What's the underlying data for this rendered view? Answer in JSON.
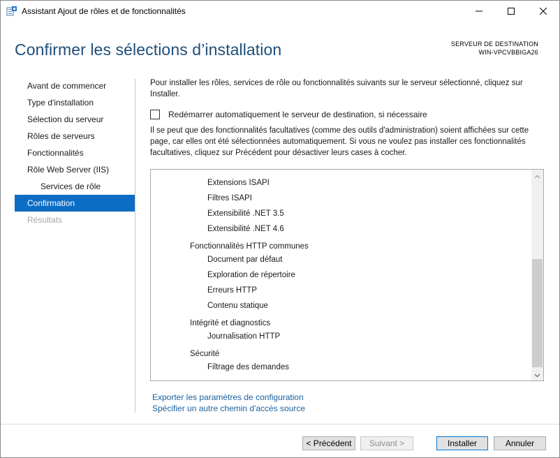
{
  "window": {
    "title": "Assistant Ajout de rôles et de fonctionnalités"
  },
  "header": {
    "page_title": "Confirmer les sélections d’installation",
    "destination_label": "SERVEUR DE DESTINATION",
    "destination_server": "WIN-VPCVBBIGA26"
  },
  "nav": {
    "items": [
      {
        "label": "Avant de commencer"
      },
      {
        "label": "Type d'installation"
      },
      {
        "label": "Sélection du serveur"
      },
      {
        "label": "Rôles de serveurs"
      },
      {
        "label": "Fonctionnalités"
      },
      {
        "label": "Rôle Web Server (IIS)"
      },
      {
        "label": "Services de rôle"
      },
      {
        "label": "Confirmation"
      },
      {
        "label": "Résultats"
      }
    ]
  },
  "content": {
    "intro": "Pour installer les rôles, services de rôle ou fonctionnalités suivants sur le serveur sélectionné, cliquez sur Installer.",
    "restart_checkbox_label": "Redémarrer automatiquement le serveur de destination, si nécessaire",
    "restart_checked": false,
    "note": "Il se peut que des fonctionnalités facultatives (comme des outils d'administration) soient affichées sur cette page, car elles ont été sélectionnées automatiquement. Si vous ne voulez pas installer ces fonctionnalités facultatives, cliquez sur Précédent pour désactiver leurs cases à cocher.",
    "list": [
      "Extensions ISAPI",
      "Filtres ISAPI",
      "Extensibilité .NET 3.5",
      "Extensibilité .NET 4.6",
      "Fonctionnalités HTTP communes",
      "Document par défaut",
      "Exploration de répertoire",
      "Erreurs HTTP",
      "Contenu statique",
      "Intégrité et diagnostics",
      "Journalisation HTTP",
      "Sécurité",
      "Filtrage des demandes"
    ],
    "export_link": "Exporter les paramètres de configuration",
    "source_link": "Spécifier un autre chemin d'accès source"
  },
  "footer": {
    "previous": "< Précédent",
    "next": "Suivant >",
    "install": "Installer",
    "cancel": "Annuler"
  },
  "icons": {
    "app": "server-manager-icon",
    "minimize": "minimize-icon",
    "maximize": "maximize-icon",
    "close": "close-icon"
  },
  "colors": {
    "title_blue": "#1e4e79",
    "nav_active": "#0c6dc5",
    "link": "#1a62a0"
  }
}
